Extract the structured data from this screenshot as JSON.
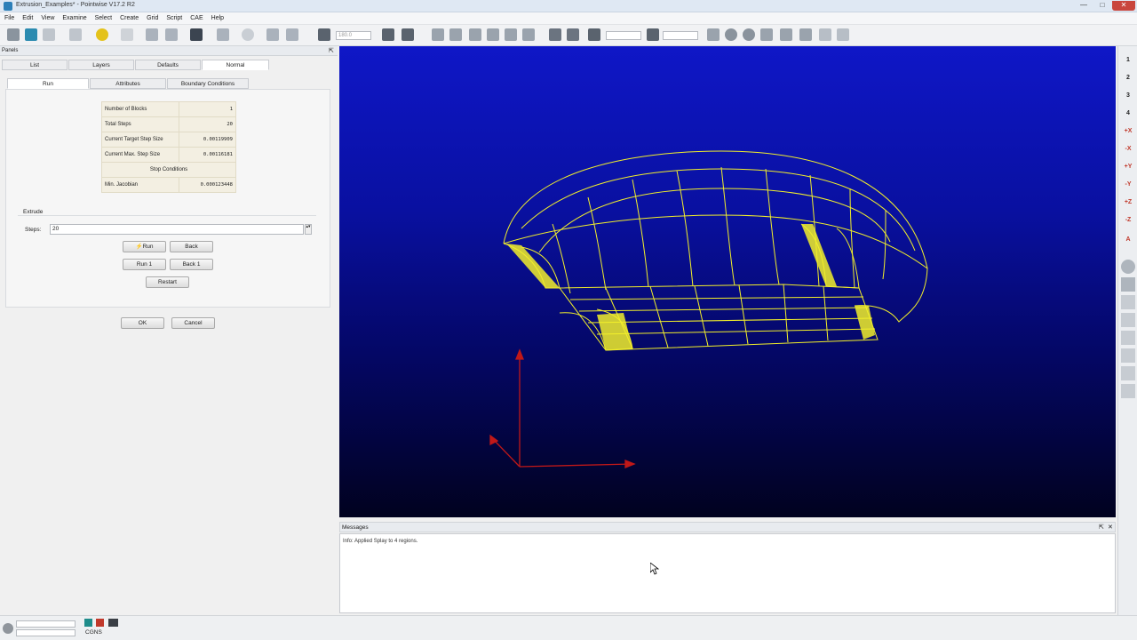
{
  "window": {
    "title": "Extrusion_Examples* - Pointwise V17.2 R2",
    "minimize": "—",
    "maximize": "□",
    "close": "✕"
  },
  "menu": [
    "File",
    "Edit",
    "View",
    "Examine",
    "Select",
    "Create",
    "Grid",
    "Script",
    "CAE",
    "Help"
  ],
  "toolbar": {
    "field_1": "180.0",
    "field_2": "",
    "field_3": ""
  },
  "panel": {
    "title": "Panels",
    "pin": "⇱",
    "main_tabs": [
      "List",
      "Layers",
      "Defaults",
      "Normal"
    ],
    "sub_tabs": [
      "Run",
      "Attributes",
      "Boundary Conditions"
    ],
    "stats": [
      {
        "label": "Number of Blocks",
        "value": "1"
      },
      {
        "label": "Total Steps",
        "value": "20"
      },
      {
        "label": "Current Target Step Size",
        "value": "0.00119909"
      },
      {
        "label": "Current Max. Step Size",
        "value": "0.00116181"
      },
      {
        "label": "Stop Conditions",
        "value": ""
      },
      {
        "label": "Min. Jacobian",
        "value": "0.000123448"
      }
    ],
    "extrude": {
      "group_title": "Extrude",
      "steps_label": "Steps:",
      "steps_value": "20",
      "run": "Run",
      "back": "Back",
      "run1": "Run 1",
      "back1": "Back 1",
      "restart": "Restart"
    },
    "ok": "OK",
    "cancel": "Cancel"
  },
  "right_toolbar": [
    "1",
    "2",
    "3",
    "4",
    "+X",
    "-X",
    "+Y",
    "-Y",
    "+Z",
    "-Z",
    "A"
  ],
  "messages": {
    "title": "Messages",
    "lines": [
      "Info: Applied Splay to 4 regions."
    ]
  },
  "status": {
    "solver": "CGNS"
  },
  "colors": {
    "mesh": "#f2ef2a",
    "axis": "#c01818",
    "viewport_top": "#0f17c7",
    "viewport_bottom": "#01021f"
  }
}
